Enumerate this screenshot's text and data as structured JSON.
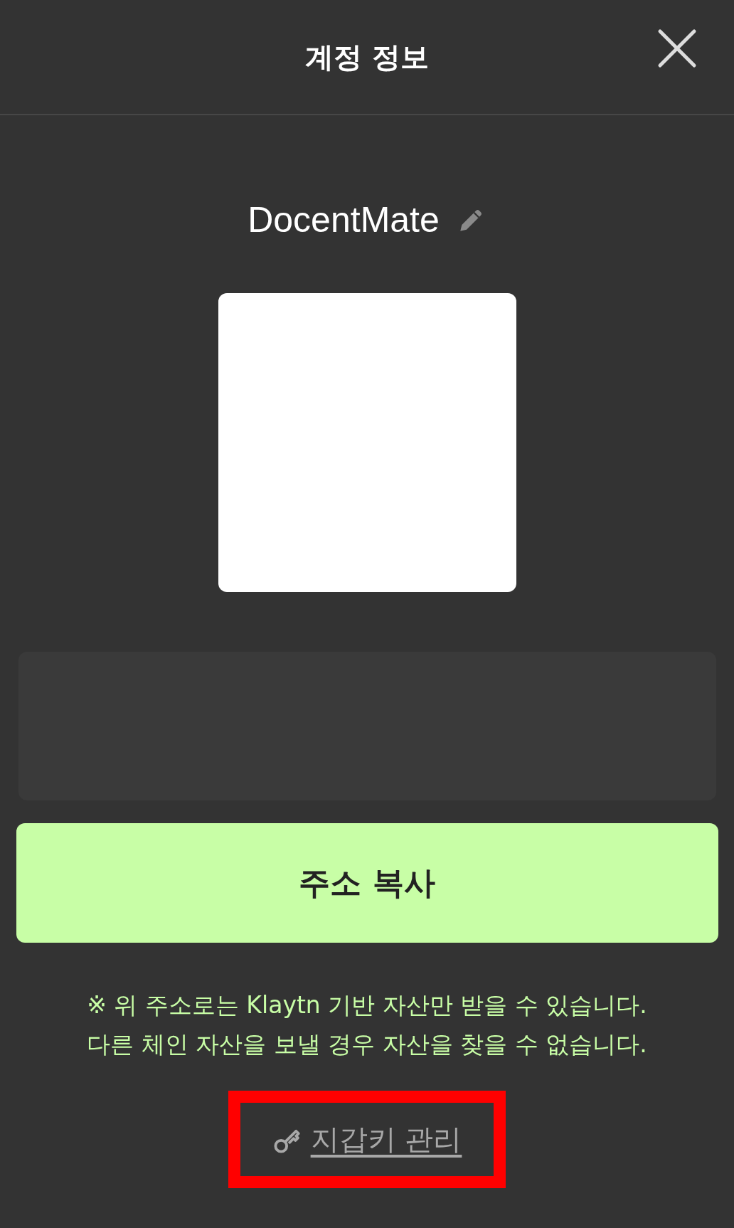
{
  "header": {
    "title": "계정 정보"
  },
  "account": {
    "name": "DocentMate"
  },
  "copy_button": {
    "label": "주소 복사"
  },
  "notice": [
    "※ 위 주소로는 Klaytn 기반 자산만 받을 수 있습니다.",
    "다른 체인 자산을 보낼 경우 자산을 찾을 수 없습니다."
  ],
  "wallet_key_link": {
    "label": "지갑키 관리",
    "highlighted": true
  }
}
